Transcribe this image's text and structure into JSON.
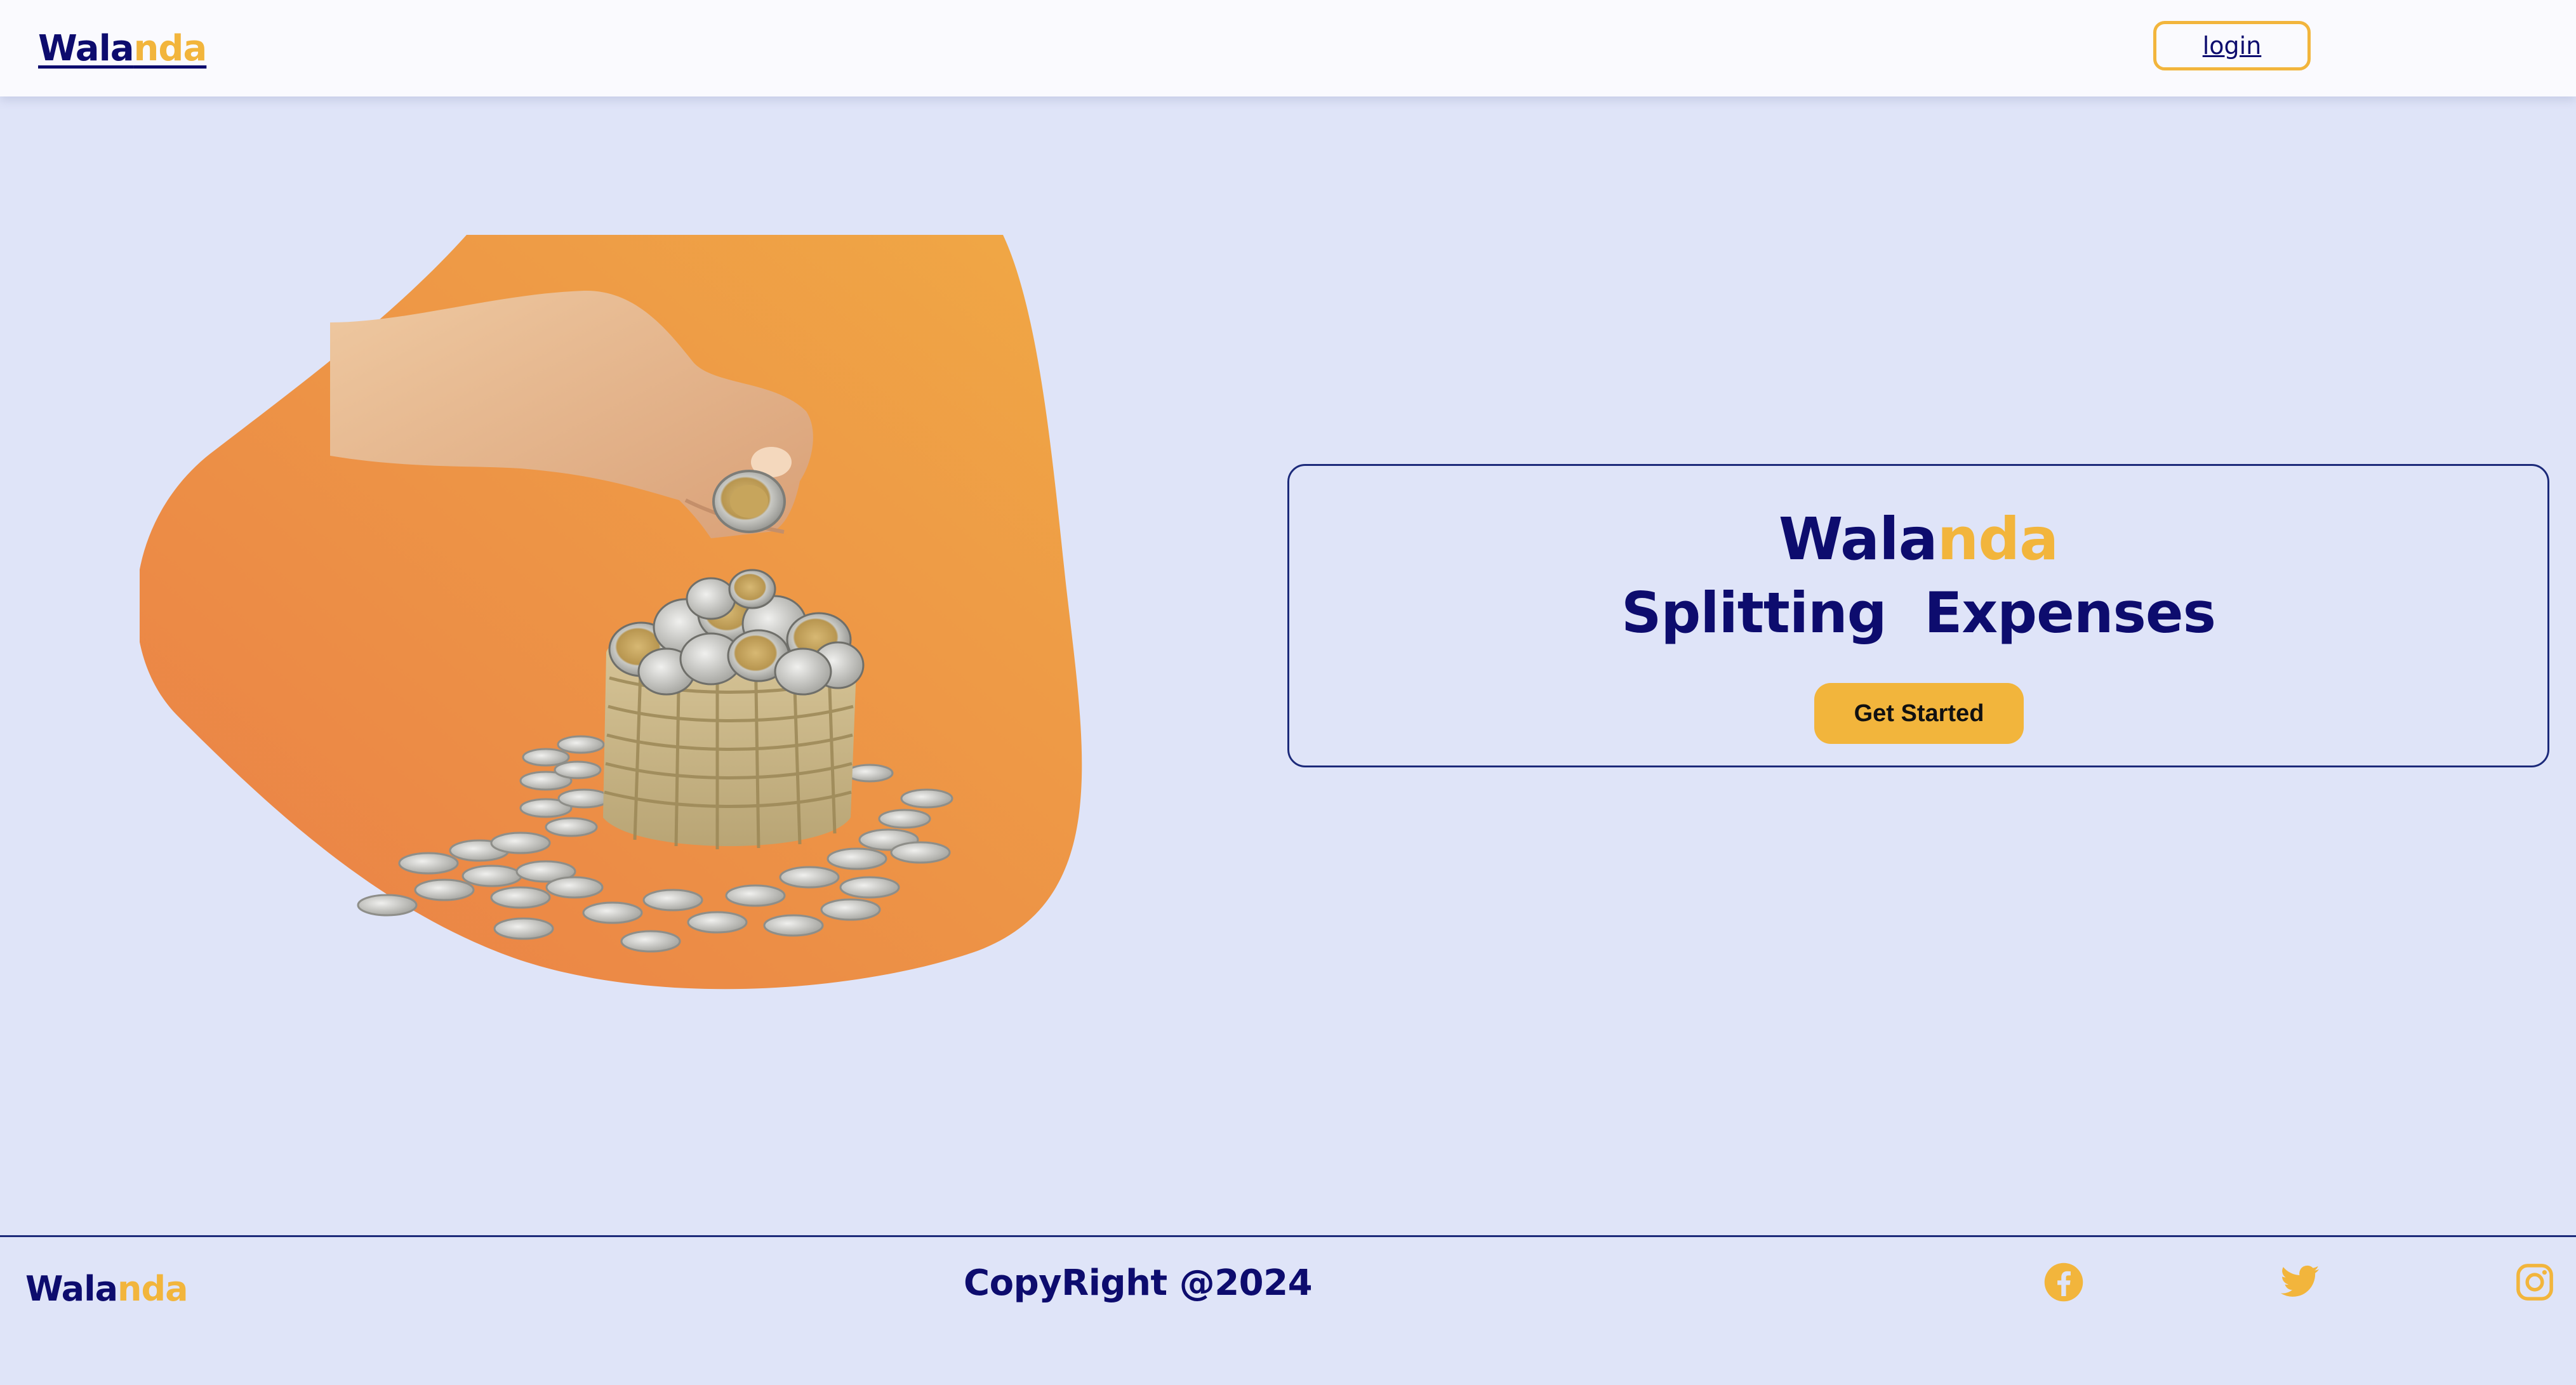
{
  "header": {
    "brand_part1": "Wala",
    "brand_part2": "nda",
    "login_label": "login"
  },
  "hero": {
    "image_alt": "hand dropping a coin into a basket of coins"
  },
  "card": {
    "brand_part1": "Wala",
    "brand_part2": "nda",
    "tagline": "Splitting  Expenses",
    "cta_label": "Get Started"
  },
  "footer": {
    "brand_part1": "Wala",
    "brand_part2": "nda",
    "copyright": "CopyRight @2024",
    "social_icons": [
      "facebook-icon",
      "twitter-icon",
      "instagram-icon"
    ]
  },
  "colors": {
    "navy": "#0d0c6e",
    "accent": "#f2b53c",
    "background": "#dfe4f8",
    "header_bg": "#fafafe",
    "blob_orange": "#ec8a48"
  }
}
